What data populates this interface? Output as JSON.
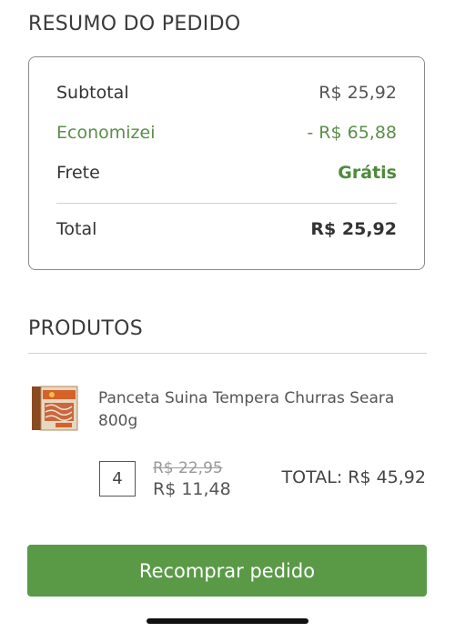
{
  "summary": {
    "title": "RESUMO DO PEDIDO",
    "subtotal_label": "Subtotal",
    "subtotal_value": "R$ 25,92",
    "savings_label": "Economizei",
    "savings_value": "- R$ 65,88",
    "shipping_label": "Frete",
    "shipping_value": "Grátis",
    "total_label": "Total",
    "total_value": "R$ 25,92"
  },
  "products": {
    "title": "PRODUTOS",
    "items": [
      {
        "name": "Panceta Suina Tempera Churras Seara 800g",
        "quantity": "4",
        "old_price": "R$ 22,95",
        "unit_price": "R$ 11,48",
        "line_total": "TOTAL: R$ 45,92"
      }
    ]
  },
  "actions": {
    "reorder_label": "Recomprar pedido"
  },
  "colors": {
    "accent_green": "#5a9a47",
    "savings_green": "#5a8f4a"
  }
}
